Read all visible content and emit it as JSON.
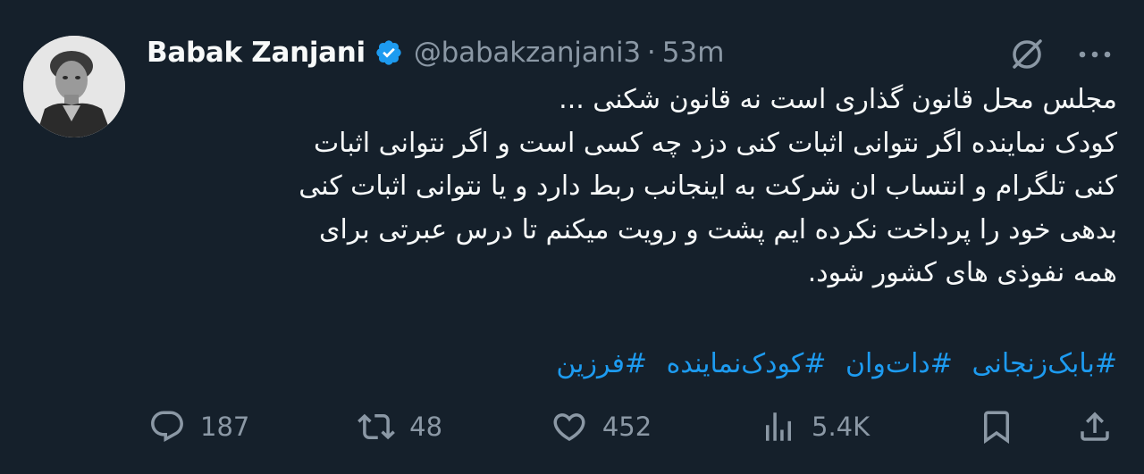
{
  "author": {
    "name": "Babak Zanjani",
    "handle": "@babakzanjani3",
    "separator": "·",
    "time": "53m",
    "verified": true
  },
  "tweet": {
    "lines": [
      "مجلس محل قانون گذاری است نه قانون شکنی ...",
      "کودک نماینده اگر نتوانی اثبات کنی دزد چه کسی است و اگر نتوانی اثبات",
      "کنی تلگرام و انتساب ان شرکت به اینجانب ربط دارد و یا نتوانی اثبات کنی",
      "بدهی خود را پرداخت نکرده ایم پشت و رویت میکنم تا درس عبرتی برای",
      "همه نفوذی های کشور شود."
    ],
    "hashtags": [
      "#بابک‌زنجانی",
      "#دات‌وان",
      "#کودک‌نماینده",
      "#فرزین"
    ]
  },
  "metrics": {
    "replies": "187",
    "retweets": "48",
    "likes": "452",
    "views": "5.4K"
  },
  "icons": {
    "verified": "verified-badge-icon",
    "grok": "grok-icon",
    "more": "more-icon",
    "reply": "reply-icon",
    "retweet": "retweet-icon",
    "like": "like-icon",
    "views": "views-icon",
    "bookmark": "bookmark-icon",
    "share": "share-icon"
  },
  "colors": {
    "background": "#15202b",
    "text": "#f7f9f9",
    "muted": "#8b98a5",
    "accent": "#1d9bf0"
  }
}
